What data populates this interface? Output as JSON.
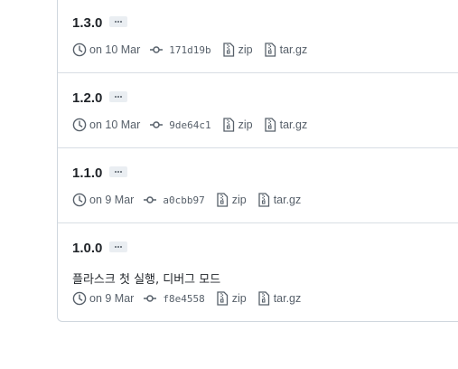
{
  "releases": [
    {
      "tag": "1.3.0",
      "date": "on 10 Mar",
      "sha": "171d19b",
      "zip_label": "zip",
      "targz_label": "tar.gz"
    },
    {
      "tag": "1.2.0",
      "date": "on 10 Mar",
      "sha": "9de64c1",
      "zip_label": "zip",
      "targz_label": "tar.gz"
    },
    {
      "tag": "1.1.0",
      "date": "on 9 Mar",
      "sha": "a0cbb97",
      "zip_label": "zip",
      "targz_label": "tar.gz"
    },
    {
      "tag": "1.0.0",
      "date": "on 9 Mar",
      "sha": "f8e4558",
      "zip_label": "zip",
      "targz_label": "tar.gz",
      "note": "플라스크 첫 실행, 디버그 모드"
    }
  ],
  "icons": {
    "clock": "clock-icon",
    "commit": "git-commit-icon",
    "zip": "file-zip-icon",
    "more": "ellipsis-icon"
  },
  "colors": {
    "muted": "#57606a",
    "border": "#d0d7de",
    "ellipsis_bg": "#eaeef2"
  }
}
